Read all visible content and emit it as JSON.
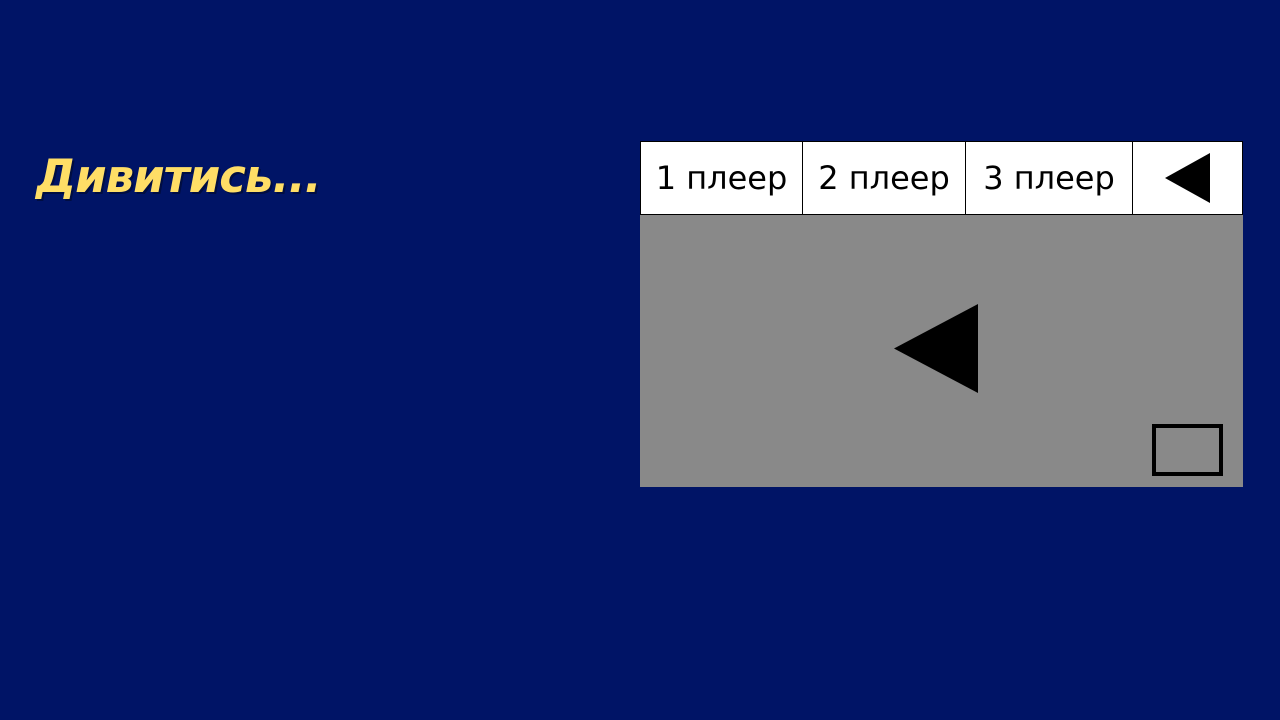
{
  "page": {
    "title": "Дивитись..."
  },
  "player": {
    "tabs": [
      {
        "label": "1 плеер"
      },
      {
        "label": "2 плеер"
      },
      {
        "label": "3 плеер"
      }
    ],
    "back_icon": "triangle-left-icon",
    "play_icon": "triangle-left-icon",
    "fullscreen_icon": "rectangle-outline-icon"
  },
  "colors": {
    "background": "#001466",
    "title": "#ffde66",
    "tab_background": "#ffffff",
    "video_background": "#898989",
    "icon": "#000000"
  }
}
